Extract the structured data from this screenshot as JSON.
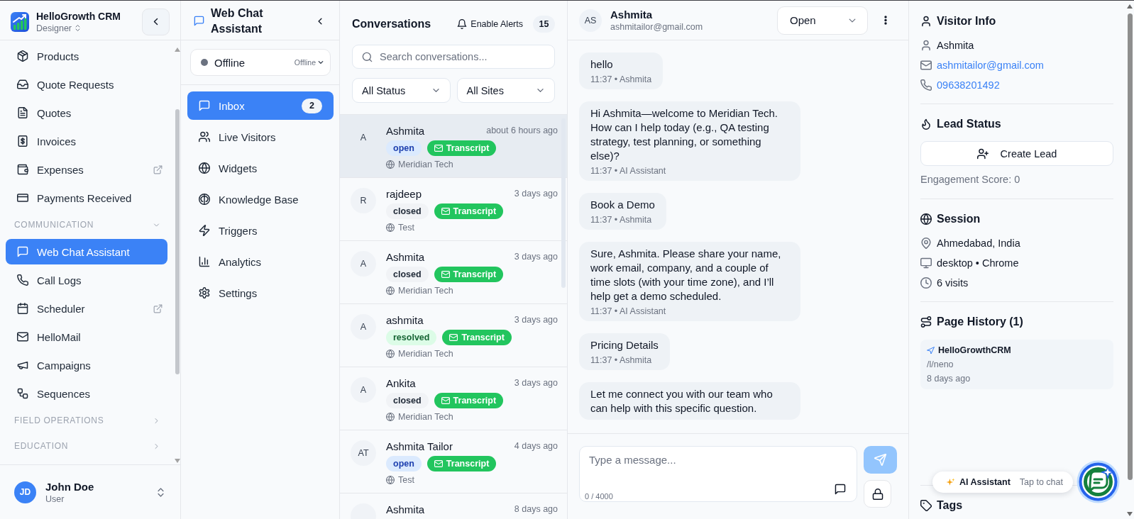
{
  "sidebar": {
    "brand": {
      "name": "HelloGrowth CRM",
      "workspace": "Designer"
    },
    "entries": [
      {
        "kind": "item",
        "label": "Products",
        "external": false,
        "selected": false
      },
      {
        "kind": "item",
        "label": "Quote Requests",
        "external": false,
        "selected": false
      },
      {
        "kind": "item",
        "label": "Quotes",
        "external": false,
        "selected": false
      },
      {
        "kind": "item",
        "label": "Invoices",
        "external": false,
        "selected": false
      },
      {
        "kind": "item",
        "label": "Expenses",
        "external": true,
        "selected": false
      },
      {
        "kind": "item",
        "label": "Payments Received",
        "external": false,
        "selected": false
      },
      {
        "kind": "section",
        "label": "COMMUNICATION",
        "expanded": true
      },
      {
        "kind": "item",
        "label": "Web Chat Assistant",
        "external": false,
        "selected": true
      },
      {
        "kind": "item",
        "label": "Call Logs",
        "external": false,
        "selected": false
      },
      {
        "kind": "item",
        "label": "Scheduler",
        "external": true,
        "selected": false
      },
      {
        "kind": "item",
        "label": "HelloMail",
        "external": false,
        "selected": false
      },
      {
        "kind": "item",
        "label": "Campaigns",
        "external": false,
        "selected": false
      },
      {
        "kind": "item",
        "label": "Sequences",
        "external": false,
        "selected": false
      },
      {
        "kind": "section",
        "label": "FIELD OPERATIONS",
        "expanded": false
      },
      {
        "kind": "section",
        "label": "EDUCATION",
        "expanded": false
      }
    ],
    "user": {
      "initials": "JD",
      "name": "John Doe",
      "role": "User"
    }
  },
  "chat_nav": {
    "title": "Web Chat Assistant",
    "status": {
      "label": "Offline",
      "value": "Offline"
    },
    "items": [
      {
        "label": "Inbox",
        "selected": true,
        "count": "2"
      },
      {
        "label": "Live Visitors",
        "selected": false
      },
      {
        "label": "Widgets",
        "selected": false
      },
      {
        "label": "Knowledge Base",
        "selected": false
      },
      {
        "label": "Triggers",
        "selected": false
      },
      {
        "label": "Analytics",
        "selected": false
      },
      {
        "label": "Settings",
        "selected": false
      }
    ]
  },
  "conversations": {
    "title": "Conversations",
    "alerts": "Enable Alerts",
    "count": "15",
    "search": {
      "placeholder": "Search conversations..."
    },
    "filters": [
      "All Status",
      "All Sites"
    ],
    "items": [
      {
        "initials": "A",
        "name": "Ashmita",
        "time": "about 6 hours ago",
        "status": {
          "label": "open",
          "kind": "open"
        },
        "transcript": "Transcript",
        "site": "Meridian Tech",
        "selected": true
      },
      {
        "initials": "R",
        "name": "rajdeep",
        "time": "3 days ago",
        "status": {
          "label": "closed",
          "kind": "closed"
        },
        "transcript": "Transcript",
        "site": "Test",
        "selected": false
      },
      {
        "initials": "A",
        "name": "Ashmita",
        "time": "3 days ago",
        "status": {
          "label": "closed",
          "kind": "closed"
        },
        "transcript": "Transcript",
        "site": "Meridian Tech",
        "selected": false
      },
      {
        "initials": "A",
        "name": "ashmita",
        "time": "3 days ago",
        "status": {
          "label": "resolved",
          "kind": "resolved"
        },
        "transcript": "Transcript",
        "site": "Meridian Tech",
        "selected": false
      },
      {
        "initials": "A",
        "name": "Ankita",
        "time": "3 days ago",
        "status": {
          "label": "closed",
          "kind": "closed"
        },
        "transcript": "Transcript",
        "site": "Meridian Tech",
        "selected": false
      },
      {
        "initials": "AT",
        "name": "Ashmita Tailor",
        "time": "4 days ago",
        "status": {
          "label": "open",
          "kind": "open"
        },
        "transcript": "Transcript",
        "site": "Test",
        "selected": false
      },
      {
        "name": "Ashmita",
        "time": "8 days ago",
        "selected": false
      }
    ]
  },
  "chat": {
    "contact": {
      "initials": "AS",
      "name": "Ashmita",
      "email": "ashmitailor@gmail.com"
    },
    "status": "Open",
    "messages": [
      {
        "text": "hello",
        "meta": "11:37 • Ashmita"
      },
      {
        "text": "Hi Ashmita—welcome to Meridian Tech. How can I help today (e.g., QA testing strategy, test planning, or something else)?",
        "meta": "11:37 • AI Assistant"
      },
      {
        "text": "Book a Demo",
        "meta": "11:37 • Ashmita"
      },
      {
        "text": "Sure, Ashmita. Please share your name, work email, company, and a couple of time slots (with your time zone), and I’ll help get a demo scheduled.",
        "meta": "11:37 • AI Assistant"
      },
      {
        "text": "Pricing Details",
        "meta": "11:37 • Ashmita"
      },
      {
        "text": "Let me connect you with our team who can help with this specific question."
      }
    ],
    "composer": {
      "placeholder": "Type a message...",
      "counter": "0 / 4000",
      "send_disabled": true
    }
  },
  "visitor": {
    "info": {
      "title": "Visitor Info",
      "name": "Ashmita",
      "email": "ashmitailor@gmail.com",
      "phone": "09638201492"
    },
    "lead": {
      "title": "Lead Status",
      "action": "Create Lead",
      "score": "Engagement Score: 0"
    },
    "session": {
      "title": "Session",
      "location": "Ahmedabad, India",
      "device": "desktop • Chrome",
      "visits": "6 visits"
    },
    "history": {
      "title": "Page History (1)",
      "pages": [
        {
          "title": "HelloGrowthCRM",
          "path": "/l/neno",
          "time": "8 days ago"
        }
      ]
    },
    "tags": {
      "title": "Tags"
    }
  },
  "assistant": {
    "label": "AI Assistant",
    "hint": "Tap to chat"
  }
}
